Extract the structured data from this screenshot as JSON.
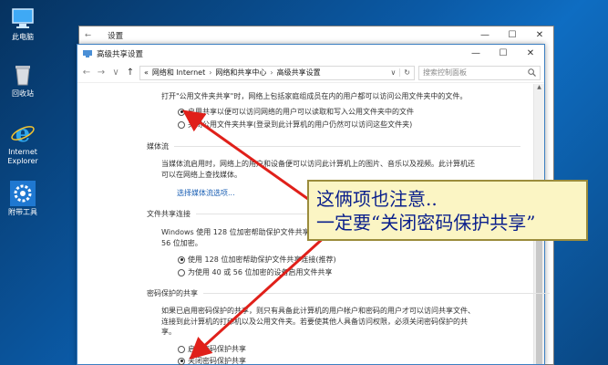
{
  "desktop": {
    "icons": [
      {
        "label": "此电脑",
        "icon": "computer-icon"
      },
      {
        "label": "回收站",
        "icon": "recycle-bin-icon"
      },
      {
        "label": "Internet Explorer",
        "icon": "ie-icon"
      },
      {
        "label": "附带工具",
        "icon": "gear-icon"
      }
    ]
  },
  "back_window": {
    "title": "设置",
    "back_arrow": "←",
    "controls": {
      "minimize": "—",
      "maximize": "☐",
      "close": "✕"
    }
  },
  "window": {
    "title": "高级共享设置",
    "controls": {
      "minimize": "—",
      "maximize": "☐",
      "close": "✕"
    },
    "nav": {
      "back": "←",
      "forward": "→",
      "recent": "∨",
      "up": "↑"
    },
    "breadcrumb": [
      "«",
      "网络和 Internet",
      "网络和共享中心",
      "高级共享设置"
    ],
    "breadcrumb_sep": "›",
    "address_dropdown": "∨",
    "refresh": "↻",
    "search_placeholder": "搜索控制面板",
    "search_icon": "search-icon"
  },
  "content": {
    "intro": "打开\"公用文件夹共享\"时，网络上包括家庭组成员在内的用户都可以访问公用文件夹中的文件。",
    "public_share": {
      "on_label": "启用共享以便可以访问网络的用户可以读取和写入公用文件夹中的文件",
      "off_label": "关闭公用文件夹共享(登录到此计算机的用户仍然可以访问这些文件夹)",
      "selected": "on"
    },
    "media": {
      "heading": "媒体流",
      "para_line1": "当媒体流启用时，网络上的用户和设备便可以访问此计算机上的图片、音乐以及视频。此计算机还",
      "para_line2": "可以在网络上查找媒体。",
      "link": "选择媒体流选项..."
    },
    "file_share": {
      "heading": "文件共享连接",
      "para_line1": "Windows 使用 128 位加密帮助保护文件共享连接。某些设备不支持 128 位加密，必须使用 40 或",
      "para_line2": "56 位加密。",
      "opt1": "使用 128 位加密帮助保护文件共享连接(推荐)",
      "opt2": "为使用 40 或 56 位加密的设备启用文件共享",
      "selected": "opt1"
    },
    "password": {
      "heading": "密码保护的共享",
      "para_line1": "如果已启用密码保护的共享，则只有具备此计算机的用户帐户和密码的用户才可以访问共享文件、",
      "para_line2": "连接到此计算机的打印机以及公用文件夹。若要使其他人具备访问权限，必须关闭密码保护的共",
      "para_line3": "享。",
      "on_label": "启用密码保护共享",
      "off_label": "关闭密码保护共享",
      "selected": "off"
    }
  },
  "annotation": {
    "line1": "这俩项也注意..",
    "line2": "一定要“关闭密码保护共享”",
    "text_color": "#0a1f8c",
    "arrow_color": "#e0201a"
  }
}
